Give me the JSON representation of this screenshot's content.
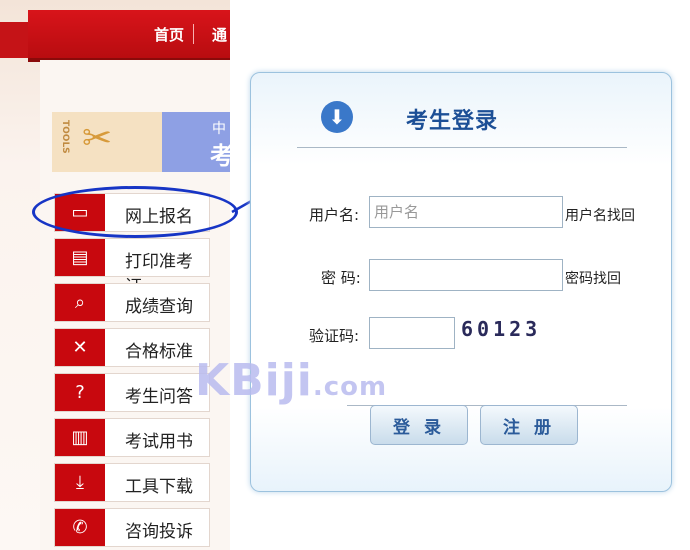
{
  "nav": {
    "home": "首页",
    "next": "通"
  },
  "banner": {
    "tools": "TOOLS",
    "line1": "中",
    "line2": "考"
  },
  "sidebar": {
    "items": [
      {
        "label": "网上报名",
        "icon": "monitor-icon"
      },
      {
        "label": "打印准考证",
        "icon": "printer-icon"
      },
      {
        "label": "成绩查询",
        "icon": "search-document-icon"
      },
      {
        "label": "合格标准",
        "icon": "tools-icon"
      },
      {
        "label": "考生问答",
        "icon": "question-icon"
      },
      {
        "label": "考试用书",
        "icon": "books-icon"
      },
      {
        "label": "工具下载",
        "icon": "download-icon"
      },
      {
        "label": "咨询投诉",
        "icon": "phone-icon"
      }
    ]
  },
  "login": {
    "title": "考生登录",
    "username_label": "用户名:",
    "username_placeholder": "用户名",
    "username_recover": "用户名找回",
    "password_label": "密 码:",
    "password_recover": "密码找回",
    "captcha_label": "验证码:",
    "captcha_text": "60123",
    "login_button": "登 录",
    "register_button": "注 册"
  },
  "watermark": {
    "main": "KBiji",
    "suffix": ".com"
  },
  "colors": {
    "brand_red": "#c8080e",
    "accent_blue": "#1735c5",
    "title_blue": "#1c4f96"
  }
}
